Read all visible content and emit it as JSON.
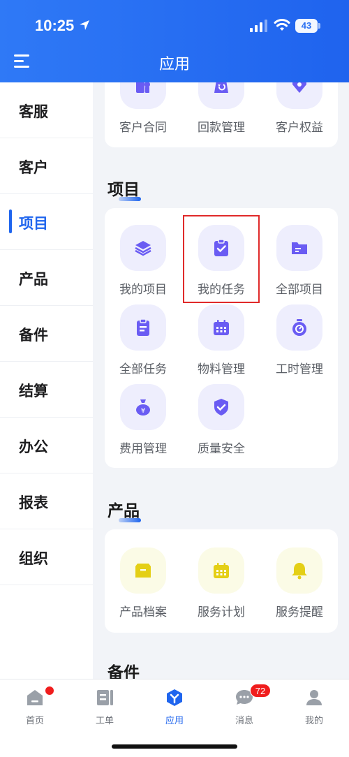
{
  "status_bar": {
    "time": "10:25",
    "battery": "43"
  },
  "header": {
    "title": "应用"
  },
  "sidebar": {
    "items": [
      {
        "label": "客服"
      },
      {
        "label": "客户"
      },
      {
        "label": "项目",
        "active": true
      },
      {
        "label": "产品"
      },
      {
        "label": "备件"
      },
      {
        "label": "结算"
      },
      {
        "label": "办公"
      },
      {
        "label": "报表"
      },
      {
        "label": "组织"
      }
    ]
  },
  "sections": {
    "customer": {
      "tiles": [
        {
          "label": "客户合同",
          "icon": "contract-icon"
        },
        {
          "label": "回款管理",
          "icon": "payment-return-icon"
        },
        {
          "label": "客户权益",
          "icon": "rights-icon"
        }
      ]
    },
    "project": {
      "title": "项目",
      "tiles": [
        {
          "label": "我的项目",
          "icon": "layers-icon"
        },
        {
          "label": "我的任务",
          "icon": "task-clipboard-icon"
        },
        {
          "label": "全部项目",
          "icon": "folder-icon"
        },
        {
          "label": "全部任务",
          "icon": "list-clipboard-icon"
        },
        {
          "label": "物料管理",
          "icon": "calendar-grid-icon"
        },
        {
          "label": "工时管理",
          "icon": "stopwatch-icon"
        },
        {
          "label": "费用管理",
          "icon": "money-bag-icon"
        },
        {
          "label": "质量安全",
          "icon": "shield-check-icon"
        }
      ]
    },
    "product": {
      "title": "产品",
      "tiles": [
        {
          "label": "产品档案",
          "icon": "archive-box-icon"
        },
        {
          "label": "服务计划",
          "icon": "calendar-icon"
        },
        {
          "label": "服务提醒",
          "icon": "bell-icon"
        }
      ]
    },
    "spare_parts": {
      "title": "备件"
    }
  },
  "tabbar": {
    "tabs": [
      {
        "label": "首页",
        "icon": "home-icon"
      },
      {
        "label": "工单",
        "icon": "work-order-icon"
      },
      {
        "label": "应用",
        "icon": "apps-icon",
        "active": true
      },
      {
        "label": "消息",
        "icon": "message-icon",
        "badge": "72"
      },
      {
        "label": "我的",
        "icon": "profile-icon"
      }
    ]
  },
  "colors": {
    "accent": "#1f65ee",
    "icon_purple": "#6a5cf3",
    "icon_yellow": "#e4cf16",
    "badge_red": "#f01d1d"
  }
}
